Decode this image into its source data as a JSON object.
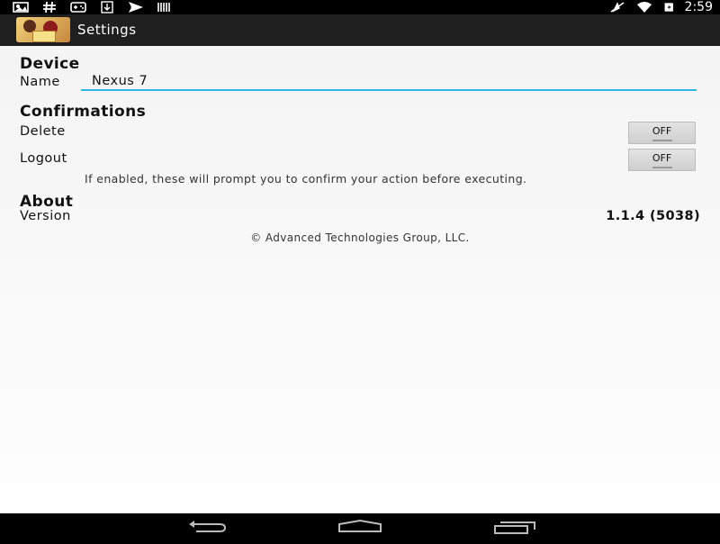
{
  "status_bar": {
    "time": "2:59",
    "left_icons": [
      "gallery-icon",
      "hash-icon",
      "gamepad-icon",
      "download-icon",
      "send-icon",
      "barcode-icon"
    ],
    "right_icons": [
      "airplane-mode-icon",
      "wifi-icon",
      "battery-icon"
    ]
  },
  "action_bar": {
    "title": "Settings"
  },
  "device": {
    "heading": "Device",
    "name_label": "Name",
    "name_value": "Nexus 7"
  },
  "confirmations": {
    "heading": "Confirmations",
    "delete_label": "Delete",
    "delete_toggle": "OFF",
    "logout_label": "Logout",
    "logout_toggle": "OFF",
    "hint": "If enabled, these will prompt you to confirm your action before executing."
  },
  "about": {
    "heading": "About",
    "version_label": "Version",
    "version_value": "1.1.4 (5038)",
    "copyright": "© Advanced Technologies Group, LLC."
  },
  "nav_bar": {
    "buttons": [
      "back-icon",
      "home-icon",
      "recents-icon"
    ]
  },
  "colors": {
    "accent": "#33b5e5",
    "action_bar": "#1f1f1f",
    "background": "#f4f4f4"
  }
}
